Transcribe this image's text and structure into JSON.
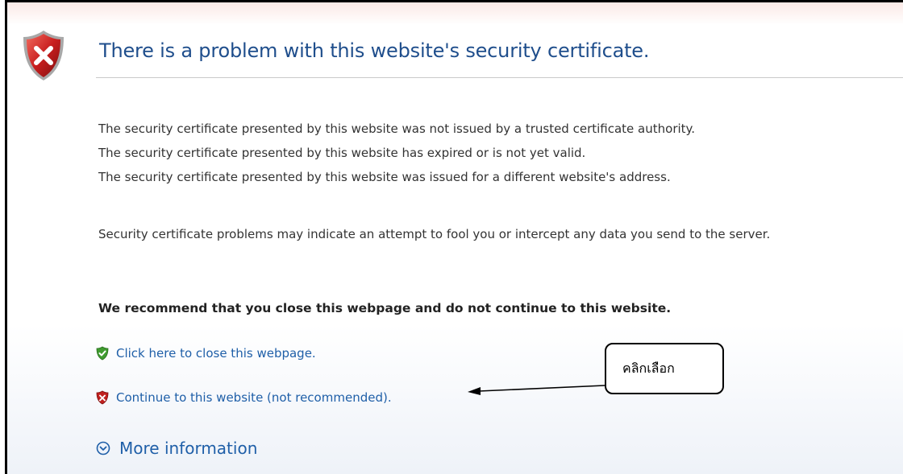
{
  "page": {
    "title": "There is a problem with this website's security certificate.",
    "reasons": [
      "The security certificate presented by this website was not issued by a trusted certificate authority.",
      "The security certificate presented by this website has expired or is not yet valid.",
      "The security certificate presented by this website was issued for a different website's address."
    ],
    "warning": "Security certificate problems may indicate an attempt to fool you or intercept any data you send to the server.",
    "recommendation": "We recommend that you close this webpage and do not continue to this website.",
    "close_link": "Click here to close this webpage.",
    "continue_link": "Continue to this website (not recommended).",
    "more_info": "More information"
  },
  "annotation": {
    "callout_text": "คลิกเลือก"
  },
  "icons": {
    "header": "error-shield-icon",
    "close_link": "green-shield-check-icon",
    "continue_link": "red-shield-x-icon",
    "more_info": "chevron-down-circle-icon"
  },
  "colors": {
    "title": "#1f4e8c",
    "link": "#1f5fa8",
    "shield_red": "#c0201f",
    "shield_green": "#3f9b2f"
  }
}
